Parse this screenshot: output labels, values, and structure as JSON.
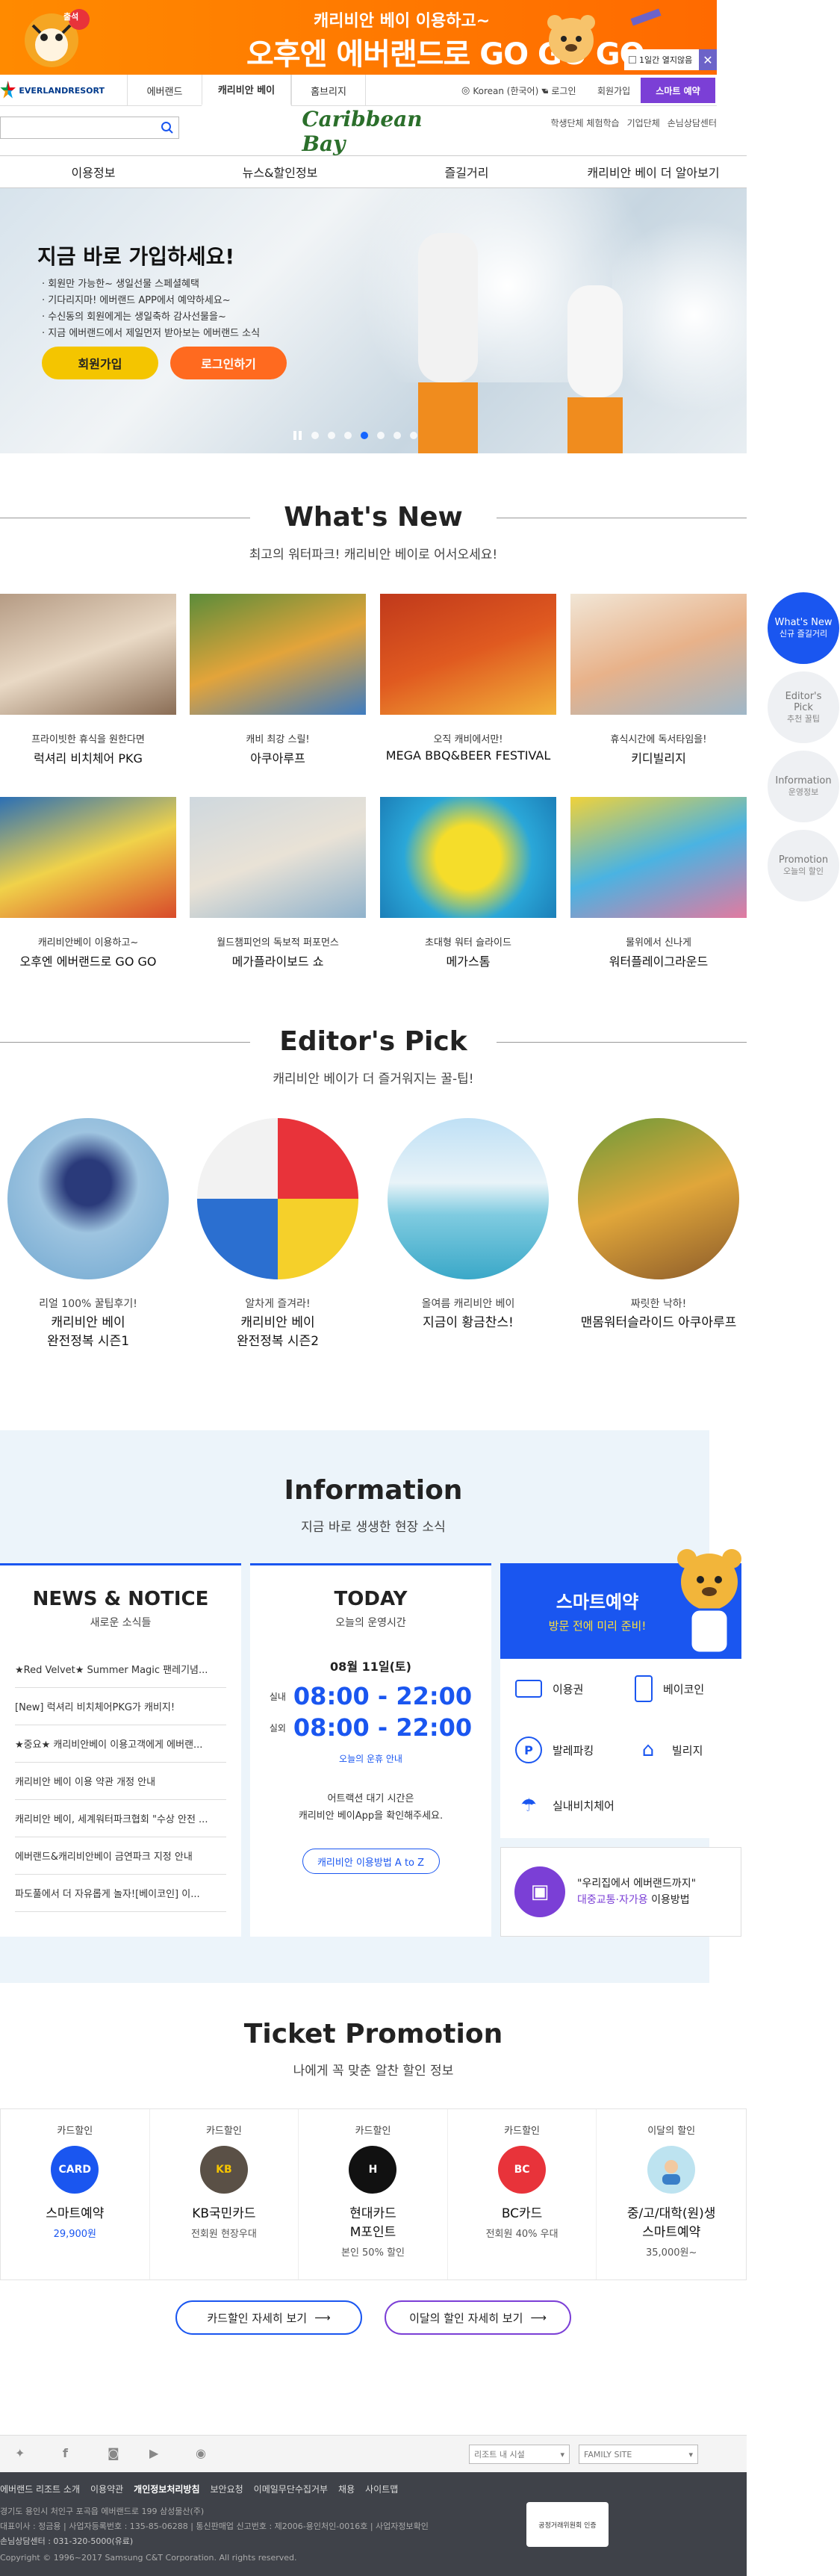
{
  "top_banner": {
    "line1": "캐리비안 베이 이용하고~",
    "line2": "오후엔 에버랜드로 GO GO GO~",
    "badge": "출석",
    "no_show": "1일간 열지않음",
    "close": "✕"
  },
  "util_nav": {
    "brand": "EVERLANDRESORT",
    "tabs": [
      "에버랜드",
      "캐리비안 베이",
      "홈브리지"
    ],
    "lang": "Korean (한국어)",
    "links": [
      "로그인",
      "회원가입"
    ],
    "smart_reserve": "스마트 예약"
  },
  "logo_row": {
    "search_placeholder": "",
    "logo": "Caribbean Bay",
    "links": [
      "학생단체 체험학습",
      "기업단체",
      "손님상담센터"
    ]
  },
  "main_nav": [
    "이용정보",
    "뉴스&할인정보",
    "즐길거리",
    "캐리비안 베이 더 알아보기"
  ],
  "hero": {
    "title": "지금 바로 가입하세요!",
    "bullets": [
      "회원만 가능한~ 생일선물 스페셜혜택",
      "기다리지마! 에버랜드 APP에서 예약하세요~",
      "수신동의 회원에게는 생일축하 감사선물을~",
      "지금 에버랜드에서 제일먼저 받아보는 에버랜드 소식"
    ],
    "join": "회원가입",
    "login": "로그인하기",
    "active_slide": 5
  },
  "whats_new": {
    "title": "What's New",
    "subtitle": "최고의 워터파크! 캐리비안 베이로 어서오세요!",
    "items": [
      {
        "sub": "프라이빗한 휴식을 원한다면",
        "name": "럭셔리 비치체어 PKG"
      },
      {
        "sub": "캐비 최강 스릴!",
        "name": "아쿠아루프"
      },
      {
        "sub": "오직 캐비에서만!",
        "name": "MEGA BBQ&BEER FESTIVAL"
      },
      {
        "sub": "휴식시간에 독서타임을!",
        "name": "키디빌리지"
      },
      {
        "sub": "캐리비안베이 이용하고~",
        "name": "오후엔 에버랜드로 GO GO"
      },
      {
        "sub": "월드챔피언의 독보적 퍼포먼스",
        "name": "메가플라이보드 쇼"
      },
      {
        "sub": "초대형 워터 슬라이드",
        "name": "메가스톰"
      },
      {
        "sub": "물위에서 신나게",
        "name": "워터플레이그라운드"
      }
    ]
  },
  "quick_nav": [
    {
      "title": "What's New",
      "sub": "신규 즐길거리"
    },
    {
      "title": "Editor's Pick",
      "sub": "추천 꿀팁"
    },
    {
      "title": "Information",
      "sub": "운영정보"
    },
    {
      "title": "Promotion",
      "sub": "오늘의 할인"
    }
  ],
  "editors_pick": {
    "title": "Editor's Pick",
    "subtitle": "캐리비안 베이가 더 즐거워지는 꿀-팁!",
    "items": [
      {
        "sub": "리얼 100% 꿀팁후기!",
        "name1": "캐리비안 베이",
        "name2": "완전정복 시즌1"
      },
      {
        "sub": "알차게 즐겨라!",
        "name1": "캐리비안 베이",
        "name2": "완전정복 시즌2"
      },
      {
        "sub": "올여름 캐리비안 베이",
        "name1": "지금이 황금찬스!",
        "name2": ""
      },
      {
        "sub": "짜릿한 낙하!",
        "name1": "맨몸워터슬라이드 아쿠아루프",
        "name2": ""
      }
    ]
  },
  "information": {
    "title": "Information",
    "subtitle": "지금 바로 생생한 현장 소식",
    "notice": {
      "title": "NEWS & NOTICE",
      "subtitle": "새로운 소식들",
      "items": [
        "★Red Velvet★ Summer Magic 팬레기념...",
        "[New] 럭셔리 비치체어PKG가 캐비지!",
        "★중요★ 캐리비안베이 이용고객에게 에버랜...",
        "캐리비안 베이 이용 약관 개정 안내",
        "캐리비안 베이, 세계워터파크협회 \"수상 안전 ...",
        "에버랜드&캐리비안베이 금연파크 지정 안내",
        "파도풀에서 더 자유롭게 놀자![베이코인] 이..."
      ]
    },
    "today": {
      "title": "TODAY",
      "subtitle": "오늘의 운영시간",
      "date": "08월 11일(토)",
      "indoor_label": "실내",
      "indoor": "08:00 - 22:00",
      "outdoor_label": "실외",
      "outdoor": "08:00 - 22:00",
      "schedule_link": "오늘의 운휴 안내",
      "note1": "어트랙션 대기 시간은",
      "note2": "캐리비안 베이App을 확인해주세요.",
      "az_button": "캐리비안 이용방법 A to Z"
    },
    "smart": {
      "title": "스마트예약",
      "subtitle": "방문 전에 미리 준비!",
      "items": [
        "이용권",
        "베이코인",
        "발레파킹",
        "빌리지",
        "실내비치체어"
      ],
      "transport1": "\"우리집에서 에버랜드까지\"",
      "transport2": "대중교통·자가용",
      "transport3": "이용방법"
    }
  },
  "ticket": {
    "title": "Ticket Promotion",
    "subtitle": "나에게 꼭 맞춘 알찬 할인 정보",
    "items": [
      {
        "cat": "카드할인",
        "logo": "CARD",
        "name": "스마트예약",
        "desc": "29,900원",
        "color": "#1a56f0"
      },
      {
        "cat": "카드할인",
        "logo": "KB",
        "name": "KB국민카드",
        "desc": "전회원 현장우대",
        "color": "#5a5046"
      },
      {
        "cat": "카드할인",
        "logo": "H",
        "name": "현대카드",
        "desc2": "M포인트",
        "desc": "본인 50% 할인",
        "color": "#111111"
      },
      {
        "cat": "카드할인",
        "logo": "BC",
        "name": "BC카드",
        "desc": "전회원 40% 우대",
        "color": "#e8333a"
      },
      {
        "cat": "이달의 할인",
        "logo": "",
        "name": "중/고/대학(원)생",
        "desc2": "스마트예약",
        "desc": "35,000원~",
        "color": "#bde3f0"
      }
    ],
    "btn1": "카드할인 자세히 보기",
    "btn2": "이달의 할인 자세히 보기"
  },
  "footer": {
    "family_select": "FAMILY SITE",
    "group_select": "리조트 내 시설",
    "links": [
      "에버랜드 리조트 소개",
      "이용약관",
      "개인정보처리방침",
      "보안요청",
      "이메일무단수집거부",
      "채용",
      "사이트맵"
    ],
    "addr": "경기도 용인시 처인구 포곡읍 에버랜드로 199 삼성물산(주)",
    "biz": "대표이사 : 정금용 | 사업자등록번호 : 135-85-06288 | 통신판매업 신고번호 : 제2006-용인처인-0016호 | 사업자정보확인",
    "cs": "손님상담센터 : 031-320-5000(유료)",
    "copy": "Copyright © 1996~2017 Samsung C&T Corporation. All rights reserved.",
    "badge": "공정거래위원회 인증"
  }
}
